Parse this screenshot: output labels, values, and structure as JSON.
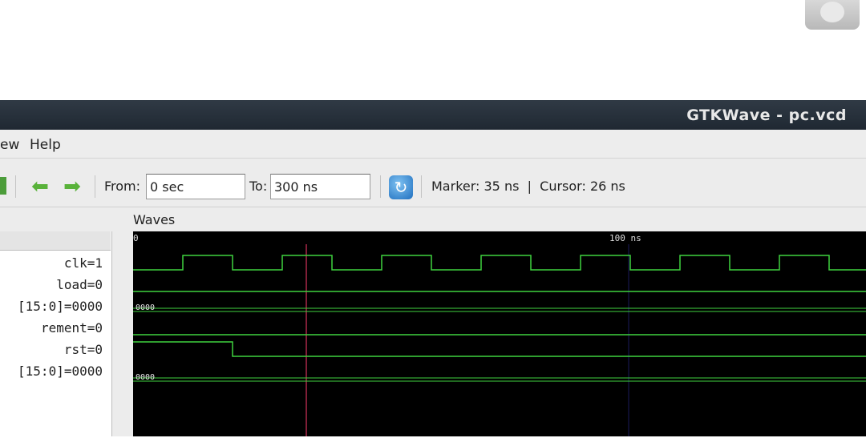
{
  "window": {
    "title": "GTKWave - pc.vcd"
  },
  "menu": {
    "items": [
      "ew",
      "Help"
    ]
  },
  "toolbar": {
    "from_label": "From:",
    "from_value": "0 sec",
    "to_label": "To:",
    "to_value": "300 ns",
    "status": "Marker: 35 ns  |  Cursor: 26 ns",
    "icons": [
      "back-arrow-icon",
      "forward-arrow-icon",
      "reload-icon"
    ]
  },
  "signals": {
    "rows": [
      "clk=1",
      "load=0",
      "[15:0]=0000",
      "rement=0",
      "rst=0",
      "[15:0]=0000"
    ]
  },
  "waves": {
    "label": "Waves",
    "ruler_start": "0",
    "ruler_mid": "100 ns",
    "bus1_value": "0000",
    "bus2_value": "0000"
  },
  "colors": {
    "trace": "#3fd23f",
    "marker": "#ff3c6e",
    "background": "#000000",
    "titlebar": "#26303b"
  }
}
